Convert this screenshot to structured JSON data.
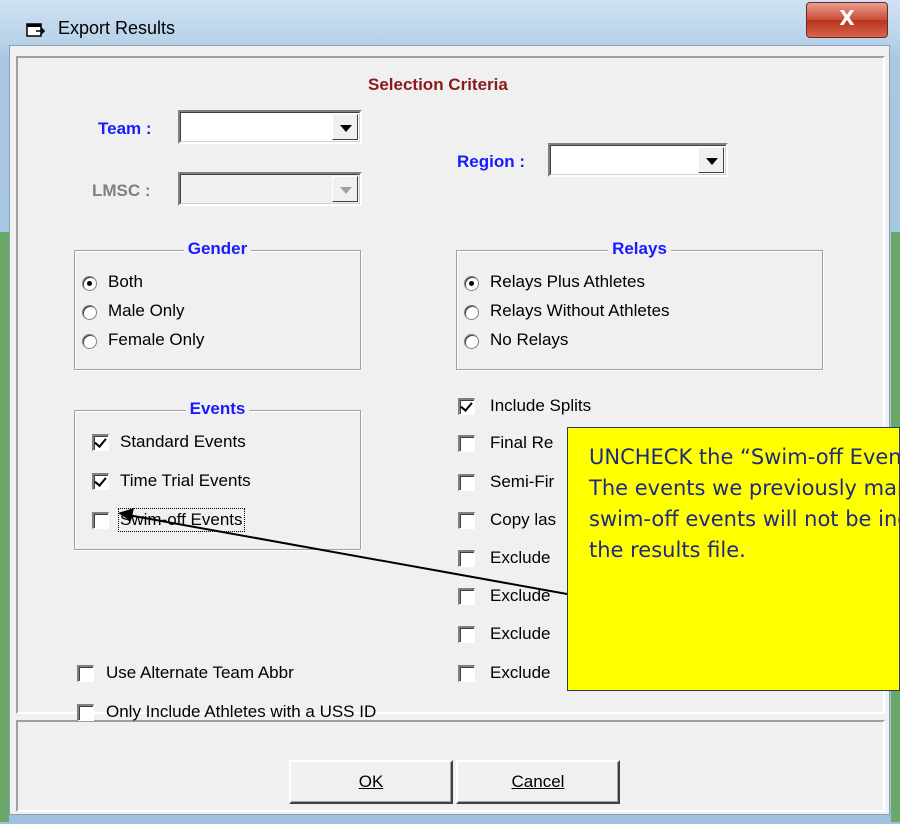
{
  "window": {
    "title": "Export Results",
    "close_symbol": "X"
  },
  "selection": {
    "heading": "Selection Criteria",
    "team_label": "Team :",
    "team_value": "",
    "region_label": "Region :",
    "region_value": "",
    "lmsc_label": "LMSC :",
    "lmsc_value": ""
  },
  "gender": {
    "title": "Gender",
    "options": [
      "Both",
      "Male Only",
      "Female Only"
    ],
    "selected": "Both"
  },
  "relays": {
    "title": "Relays",
    "options": [
      "Relays Plus Athletes",
      "Relays Without Athletes",
      "No Relays"
    ],
    "selected": "Relays Plus Athletes"
  },
  "events": {
    "title": "Events",
    "items": [
      {
        "label": "Standard Events",
        "checked": true
      },
      {
        "label": "Time Trial Events",
        "checked": true
      },
      {
        "label": "Swim-off Events",
        "checked": false
      }
    ]
  },
  "right_options": [
    {
      "label": "Include Splits",
      "checked": true
    },
    {
      "label": "Final Re",
      "checked": false
    },
    {
      "label": "Semi-Fir",
      "checked": false
    },
    {
      "label": "Copy las",
      "checked": false
    },
    {
      "label": "Exclude",
      "checked": false
    },
    {
      "label": "Exclude",
      "checked": false
    },
    {
      "label": "Exclude",
      "checked": false
    },
    {
      "label": "Exclude",
      "checked": false
    }
  ],
  "left_options": [
    {
      "label": "Use Alternate Team Abbr",
      "checked": false
    },
    {
      "label": "Only Include Athletes with a USS ID",
      "checked": false
    }
  ],
  "buttons": {
    "ok": "OK",
    "cancel": "Cancel"
  },
  "callout": {
    "text": "UNCHECK the “Swim-off Events” box.  The events we previously marked as swim-off events will not be included in the results file."
  },
  "colors": {
    "heading": "#8b1a1a",
    "label_blue": "#1a1aff",
    "callout_bg": "#ffff00",
    "callout_text": "#1f2a7a"
  }
}
